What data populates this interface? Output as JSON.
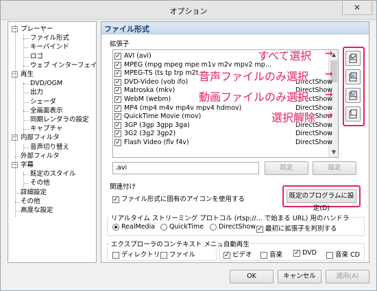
{
  "window": {
    "title": "オプション",
    "close_glyph": "✕"
  },
  "tree": {
    "items": [
      {
        "label": "プレーヤー",
        "level": 0,
        "expanded": true
      },
      {
        "label": "ファイル形式",
        "level": 1
      },
      {
        "label": "キーバインド",
        "level": 1
      },
      {
        "label": "ロゴ",
        "level": 1
      },
      {
        "label": "ウェブ インターフェイス",
        "level": 1
      },
      {
        "label": "再生",
        "level": 0,
        "expanded": true
      },
      {
        "label": "DVD/OGM",
        "level": 1
      },
      {
        "label": "出力",
        "level": 1
      },
      {
        "label": "シェーダ",
        "level": 1
      },
      {
        "label": "全画面表示",
        "level": 1
      },
      {
        "label": "同期レンダラの設定",
        "level": 1
      },
      {
        "label": "キャプチャ",
        "level": 1
      },
      {
        "label": "内部フィルタ",
        "level": 0,
        "expanded": true
      },
      {
        "label": "音声切り替え",
        "level": 1
      },
      {
        "label": "外部フィルタ",
        "level": 0
      },
      {
        "label": "字幕",
        "level": 0,
        "expanded": true
      },
      {
        "label": "既定のスタイル",
        "level": 1
      },
      {
        "label": "その他",
        "level": 1
      },
      {
        "label": "詳細設定",
        "level": 0
      },
      {
        "label": "その他",
        "level": 0
      },
      {
        "label": "高度な設定",
        "level": 0
      }
    ]
  },
  "panel": {
    "title": "ファイル形式",
    "extensions_label": "拡張子",
    "formats": [
      {
        "name": "AVI (avi)",
        "source": "",
        "checked": true
      },
      {
        "name": "MPEG (mpg mpeg mpe m1v m2v mpv2 mp...",
        "source": "",
        "checked": true
      },
      {
        "name": "MPEG-TS (ts tp trp m2t m...",
        "source": "",
        "checked": true
      },
      {
        "name": "DVD-Video (vob ifo)",
        "source": "DirectShow",
        "checked": true
      },
      {
        "name": "Matroska (mkv)",
        "source": "DirectShow",
        "checked": true
      },
      {
        "name": "WebM (webm)",
        "source": "DirectShow",
        "checked": true
      },
      {
        "name": "MP4 (mp4 m4v mp4v mpv4 hdmov)",
        "source": "DirectShow",
        "checked": true
      },
      {
        "name": "QuickTime Movie (mov)",
        "source": "DirectShow",
        "checked": true
      },
      {
        "name": "3GP (3gp 3gpp 3ga)",
        "source": "DirectShow",
        "checked": true
      },
      {
        "name": "3G2 (3g2 3gp2)",
        "source": "DirectShow",
        "checked": true
      },
      {
        "name": "Flash Video (flv f4v)",
        "source": "DirectShow",
        "checked": true
      }
    ],
    "ext_value": ".avi",
    "default_button": "既定",
    "set_button": "設定",
    "association_label": "関連付け",
    "icon_checkbox_label": "ファイル形式に固有のアイコンを使用する",
    "default_program_button": "既定のプログラムに設定(D)",
    "rtsp_label": "リアルタイム ストリーミング プロトコル (rtsp://... で始まる URL) 用のハンドラ",
    "rtsp_options": [
      "RealMedia",
      "QuickTime",
      "DirectShow"
    ],
    "rtsp_selected": "RealMedia",
    "first_ext_label": "最初に拡張子を判別する",
    "explorer_label": "エクスプローラのコンテキスト メニュー",
    "explorer_options": [
      "ディレクトリ",
      "ファイル"
    ],
    "autoplay_label": "自動再生",
    "autoplay_options": [
      {
        "label": "ビデオ",
        "checked": true
      },
      {
        "label": "音楽",
        "checked": false
      },
      {
        "label": "DVD",
        "checked": true
      },
      {
        "label": "音楽 CD",
        "checked": false
      }
    ]
  },
  "side_buttons": [
    {
      "icon": "select-all-icon",
      "glyph": "✓"
    },
    {
      "icon": "audio-only-icon",
      "glyph": "A"
    },
    {
      "icon": "video-only-icon",
      "glyph": "V"
    },
    {
      "icon": "deselect-icon",
      "glyph": ""
    }
  ],
  "annotations": {
    "select_all": "すべて選択",
    "audio_only": "音声ファイルのみ選択",
    "video_only": "動画ファイルのみ選択",
    "deselect": "選択解除"
  },
  "footer": {
    "ok": "OK",
    "cancel": "キャンセル",
    "apply": "適用(A)"
  },
  "colors": {
    "accent_red": "#e7205b",
    "header_blue": "#1c3e72"
  }
}
